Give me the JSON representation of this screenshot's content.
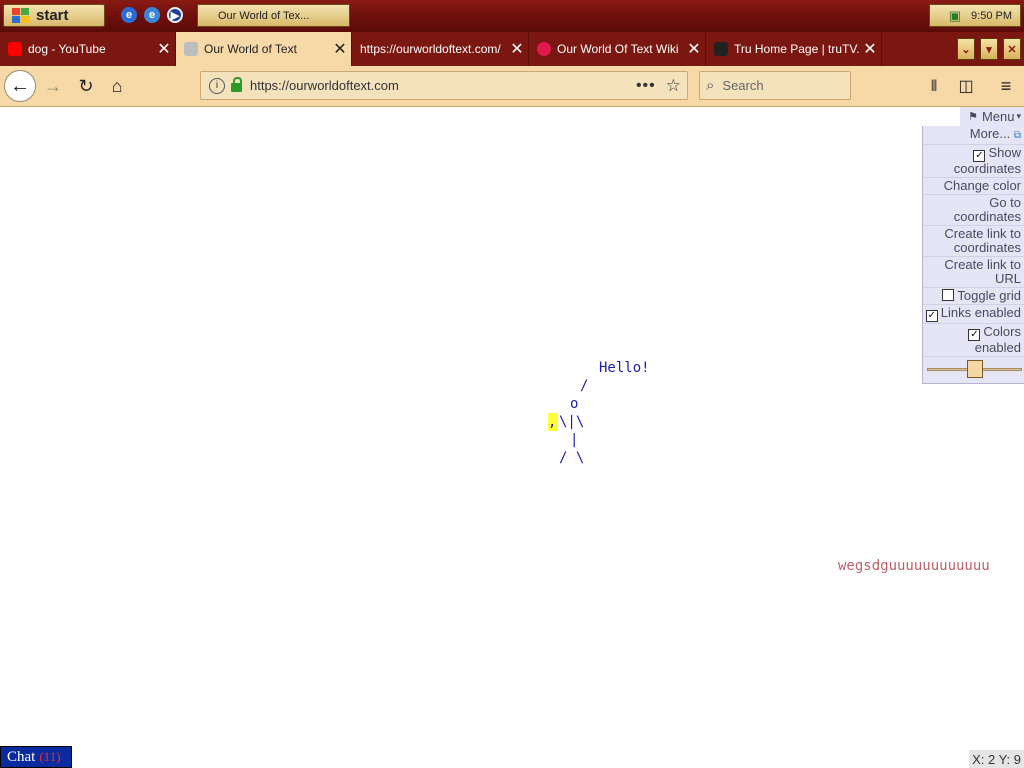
{
  "taskbar": {
    "start_label": "start",
    "quick_launch": [
      {
        "icon": "internet-explorer-icon"
      },
      {
        "icon": "outlook-express-icon"
      },
      {
        "icon": "media-player-icon"
      }
    ],
    "active_task": "Our World of Tex...",
    "clock": "9:50 PM"
  },
  "tabs": [
    {
      "label": "dog - YouTube",
      "active": false,
      "favicon_color": "#ff0000"
    },
    {
      "label": "Our World of Text",
      "active": true,
      "favicon_color": "#888888"
    },
    {
      "label": "https://ourworldoftext.com/",
      "active": false,
      "favicon_color": ""
    },
    {
      "label": "Our World Of Text Wiki",
      "active": false,
      "favicon_color": "#e0194f"
    },
    {
      "label": "Tru Home Page | truTV.c",
      "active": false,
      "favicon_color": "#222222"
    }
  ],
  "navbar": {
    "url": "https://ourworldoftext.com",
    "search_placeholder": "Search"
  },
  "canvas": {
    "hello": "Hello!",
    "art_slash": "/",
    "art_head": "o",
    "art_comma": ",",
    "art_body": "\\|\\",
    "art_torso": "|",
    "art_legs": "/ \\",
    "long_text": "wegsdguuuuuuuuuuuu"
  },
  "menu": {
    "header": "Menu",
    "more": "More...",
    "items": [
      {
        "label": "Show coordinates",
        "checkbox": true,
        "checked": true
      },
      {
        "label": "Change color",
        "checkbox": false
      },
      {
        "label": "Go to coordinates",
        "checkbox": false
      },
      {
        "label": "Create link to coordinates",
        "checkbox": false
      },
      {
        "label": "Create link to URL",
        "checkbox": false
      },
      {
        "label": "Toggle grid",
        "checkbox": true,
        "checked": false
      },
      {
        "label": "Links enabled",
        "checkbox": true,
        "checked": true
      },
      {
        "label": "Colors enabled",
        "checkbox": true,
        "checked": true
      }
    ],
    "zoom_level": 0.5
  },
  "chat": {
    "label": "Chat",
    "count": "(11)"
  },
  "coordinates": "X: 2 Y: 9",
  "colors": {
    "accent": "#7a1710",
    "text_blue": "#1d1da8",
    "long_text_color": "#c0606a",
    "highlight": "#ffff3a"
  }
}
